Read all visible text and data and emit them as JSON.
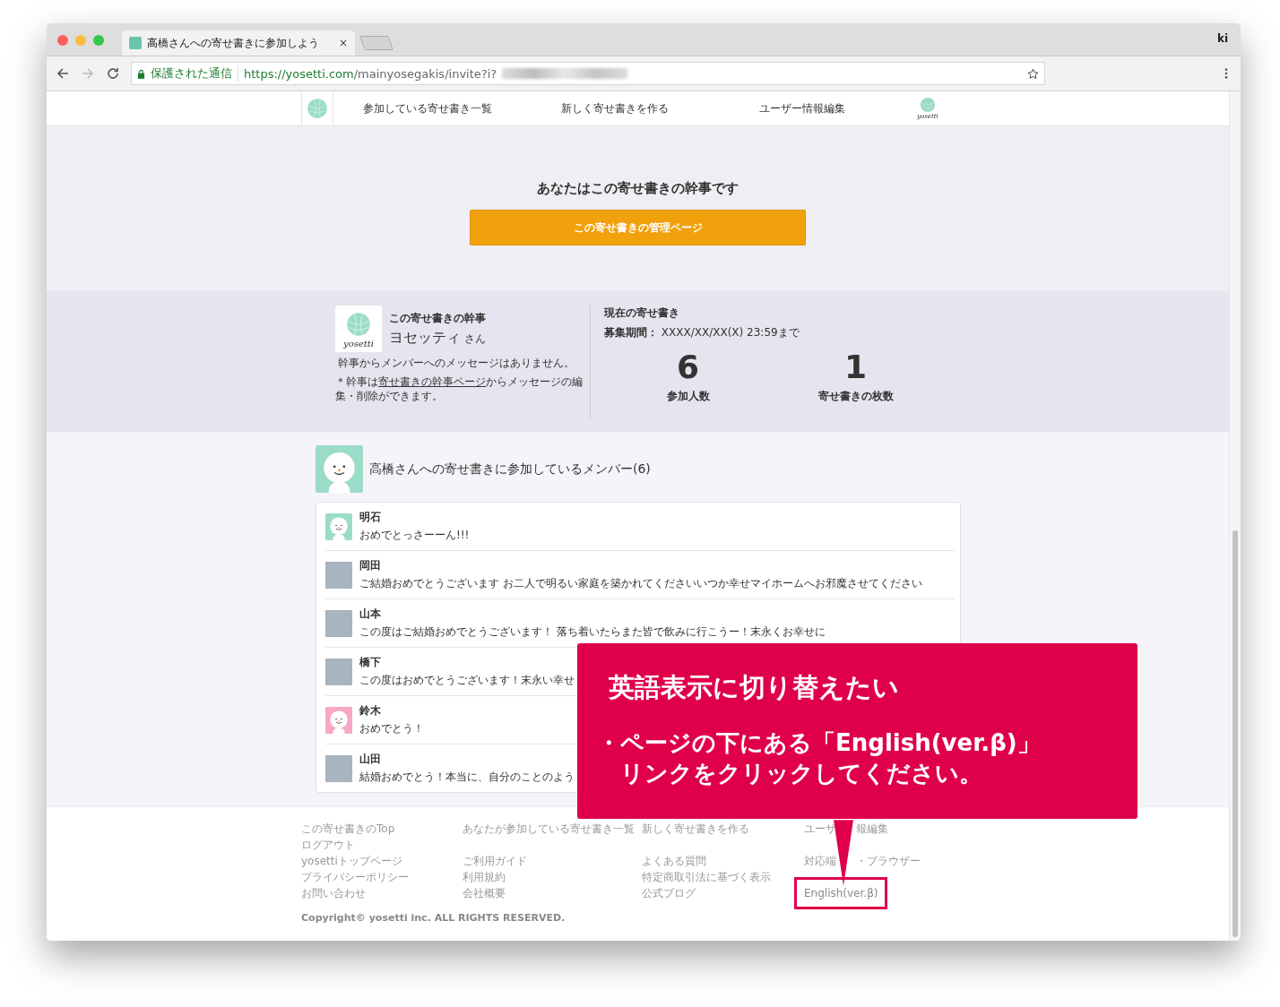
{
  "browser": {
    "tab_title": "高橋さんへの寄せ書きに参加しよう",
    "tab_close": "×",
    "security_label": "保護された通信",
    "url_host": "https://yosetti.com",
    "url_path": "/mainyosegakis/invite?i?",
    "profile": "ki"
  },
  "nav": {
    "items": [
      "参加している寄せ書き一覧",
      "新しく寄せ書きを作る",
      "ユーザー情報編集"
    ],
    "logo_text": "yosetti"
  },
  "hero": {
    "heading": "あなたはこの寄せ書きの幹事です",
    "button": "この寄せ書きの管理ページ"
  },
  "organizer": {
    "label": "この寄せ書きの幹事",
    "name": "ヨセッティ",
    "honorific": "さん",
    "avatar_text": "yosetti",
    "message": "幹事からメンバーへのメッセージはありません。",
    "note_before": "＊幹事は",
    "note_link": "寄せ書きの幹事ページ",
    "note_after": "からメッセージの編集・削除ができます。"
  },
  "current": {
    "title": "現在の寄せ書き",
    "period_label": "募集期間：",
    "period_value": "XXXX/XX/XX(X) 23:59まで",
    "stats": [
      {
        "value": "6",
        "label": "参加人数"
      },
      {
        "value": "1",
        "label": "寄せ書きの枚数"
      }
    ]
  },
  "members": {
    "heading": "高橋さんへの寄せ書きに参加しているメンバー(6)",
    "items": [
      {
        "name": "明石",
        "message": "おめでとっさーーん!!!",
        "kind": "mascot",
        "color": "#9bdcc8"
      },
      {
        "name": "岡田",
        "message": "ご結婚おめでとうございます お二人で明るい家庭を築かれてくださいいつか幸せマイホームへお邪魔させてください",
        "kind": "photo"
      },
      {
        "name": "山本",
        "message": "この度はご結婚おめでとうございます！ 落ち着いたらまた皆で飲みに行こうー！末永くお幸せに",
        "kind": "photo"
      },
      {
        "name": "橋下",
        "message": "この度はおめでとうございます！末永い幸せ",
        "kind": "photo"
      },
      {
        "name": "鈴木",
        "message": "おめでとう！",
        "kind": "mascot",
        "color": "#f7a8c4"
      },
      {
        "name": "山田",
        "message": "結婚おめでとう！本当に、自分のことのよう",
        "kind": "photo"
      }
    ]
  },
  "footer": {
    "columns": [
      {
        "top": [
          "この寄せ書きのTop",
          "ログアウト"
        ],
        "bottom": [
          {
            "label": "yosettiトップページ",
            "highlighted": false
          },
          {
            "label": "プライバシーポリシー",
            "highlighted": false
          },
          {
            "label": "お問い合わせ",
            "highlighted": false
          }
        ]
      },
      {
        "top": [
          "あなたが参加している寄せ書き一覧"
        ],
        "bottom": [
          {
            "label": "ご利用ガイド",
            "highlighted": false
          },
          {
            "label": "利用規約",
            "highlighted": false
          },
          {
            "label": "会社概要",
            "highlighted": false
          }
        ]
      },
      {
        "top": [
          "新しく寄せ書きを作る"
        ],
        "bottom": [
          {
            "label": "よくある質問",
            "highlighted": false
          },
          {
            "label": "特定商取引法に基づく表示",
            "highlighted": false
          },
          {
            "label": "公式ブログ",
            "highlighted": false
          }
        ]
      },
      {
        "top": [
          [
            "ユーザ",
            "報編集"
          ]
        ],
        "bottom": [
          {
            "label": [
              "対応端",
              "・ブラウザー"
            ],
            "highlighted": false
          },
          {
            "label": "English(ver.β)",
            "highlighted": true
          }
        ]
      }
    ],
    "copyright": "Copyright© yosetti inc. ALL RIGHTS RESERVED."
  },
  "callout": {
    "title": "英語表示に切り替えたい",
    "bullet": "・",
    "lines": [
      "ページの下にある「English(ver.β)」",
      "リンクをクリックしてください。"
    ]
  }
}
